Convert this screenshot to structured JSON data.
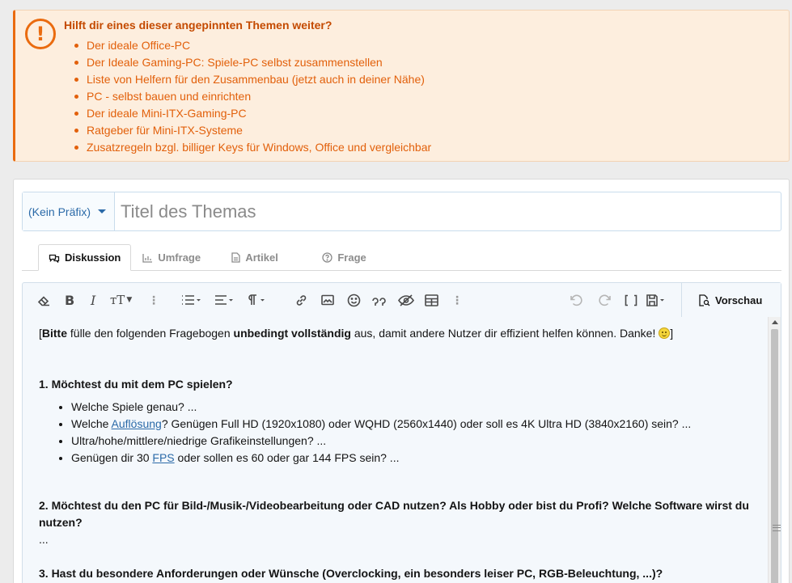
{
  "notice": {
    "icon": "exclamation-circle-icon",
    "title": "Hilft dir eines dieser angepinnten Themen weiter?",
    "links": [
      "Der ideale Office-PC",
      "Der Ideale Gaming-PC: Spiele-PC selbst zusammenstellen",
      "Liste von Helfern für den Zusammenbau (jetzt auch in deiner Nähe)",
      "PC - selbst bauen und einrichten",
      "Der ideale Mini-ITX-Gaming-PC",
      "Ratgeber für Mini-ITX-Systeme",
      "Zusatzregeln bzgl. billiger Keys für Windows, Office und vergleichbar"
    ]
  },
  "thread": {
    "prefix_label": "(Kein Präfix)",
    "title_placeholder": "Titel des Themas",
    "title_value": ""
  },
  "tabs": [
    {
      "label": "Diskussion",
      "icon": "comments-icon",
      "active": true
    },
    {
      "label": "Umfrage",
      "icon": "bar-chart-icon",
      "active": false
    },
    {
      "label": "Artikel",
      "icon": "file-icon",
      "active": false
    },
    {
      "label": "Frage",
      "icon": "question-circle-icon",
      "active": false
    }
  ],
  "toolbar": {
    "preview_label": "Vorschau",
    "buttons": [
      "eraser-icon",
      "bold-icon",
      "italic-icon",
      "font-size-icon",
      "more-icon",
      "list-icon",
      "align-icon",
      "paragraph-icon",
      "more-icon",
      "link-icon",
      "image-icon",
      "smile-icon",
      "quote-icon",
      "spoiler-icon",
      "table-icon",
      "more-icon",
      "undo-icon",
      "redo-icon",
      "bbcode-icon",
      "drafts-icon"
    ]
  },
  "editor": {
    "intro_open": "[",
    "intro_bold1": "Bitte",
    "intro_mid1": " fülle den folgenden Fragebogen ",
    "intro_bold2": "unbedingt vollständig",
    "intro_mid2": " aus, damit andere Nutzer dir effizient helfen können. Danke! ",
    "intro_close": "]",
    "q1": "1. Möchtest du mit dem PC spielen?",
    "q1_items": {
      "a": "Welche Spiele genau? ...",
      "b_pre": "Welche ",
      "b_link": "Auflösung",
      "b_post": "? Genügen Full HD (1920x1080) oder WQHD (2560x1440) oder soll es 4K Ultra HD (3840x2160) sein? ...",
      "c": "Ultra/hohe/mittlere/niedrige Grafikeinstellungen? ...",
      "d_pre": "Genügen dir 30 ",
      "d_link": "FPS",
      "d_post": " oder sollen es 60 oder gar 144 FPS sein? ..."
    },
    "q2": "2. Möchtest du den PC für Bild-/Musik-/Videobearbeitung oder CAD nutzen? Als Hobby oder bist du Profi? Welche Software wirst du nutzen?",
    "q2_answer": "...",
    "q3": "3. Hast du besondere Anforderungen oder Wünsche (Overclocking, ein besonders leiser PC, RGB-Beleuchtung, ...)?"
  }
}
